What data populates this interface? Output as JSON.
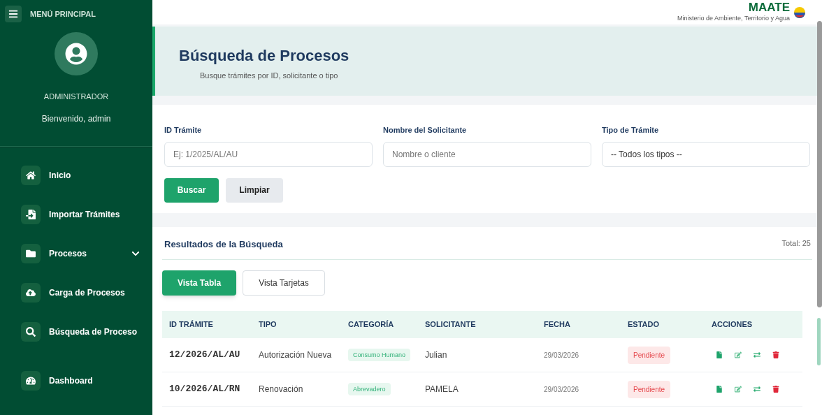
{
  "sidebar": {
    "menu_title": "MENÚ PRINCIPAL",
    "user_role": "ADMINISTRADOR",
    "welcome": "Bienvenido, admin",
    "items": [
      {
        "label": "Inicio",
        "expandable": false
      },
      {
        "label": "Importar Trámites",
        "expandable": false
      },
      {
        "label": "Procesos",
        "expandable": true
      },
      {
        "label": "Carga de Procesos",
        "expandable": false
      },
      {
        "label": "Búsqueda de Proceso",
        "expandable": false
      },
      {
        "label": "Dashboard",
        "expandable": false
      }
    ]
  },
  "header": {
    "logo": "MAATE",
    "ministry": "Ministerio de Ambiente, Territorio y Agua"
  },
  "page": {
    "title": "Búsqueda de Procesos",
    "subtitle": "Busque trámites por ID, solicitante o tipo"
  },
  "search_form": {
    "fields": [
      {
        "label": "ID Trámite",
        "placeholder": "Ej: 1/2025/AL/AU",
        "kind": "input"
      },
      {
        "label": "Nombre del Solicitante",
        "placeholder": "Nombre o cliente",
        "kind": "input"
      },
      {
        "label": "Tipo de Trámite",
        "value": "-- Todos los tipos --",
        "kind": "select"
      }
    ],
    "buttons": [
      {
        "label": "Buscar",
        "kind": "primary"
      },
      {
        "label": "Limpiar",
        "kind": "secondary"
      }
    ]
  },
  "results": {
    "title": "Resultados de la Búsqueda",
    "total": "Total: 25",
    "view_tabs": [
      {
        "label": "Vista Tabla",
        "selected": true
      },
      {
        "label": "Vista Tarjetas",
        "selected": false
      }
    ],
    "table": {
      "columns": [
        "ID TRÁMITE",
        "TIPO",
        "CATEGORÍA",
        "SOLICITANTE",
        "FECHA",
        "ESTADO",
        "ACCIONES"
      ],
      "rows": [
        {
          "id": "12/2026/AL/AU",
          "tipo": "Autorización Nueva",
          "categoria": "Consumo Humano",
          "solicitante": "Julian",
          "fecha": "29/03/2026",
          "estado": "Pendiente"
        },
        {
          "id": "10/2026/AL/RN",
          "tipo": "Renovación",
          "categoria": "Abrevadero",
          "solicitante": "PAMELA",
          "fecha": "29/03/2026",
          "estado": "Pendiente"
        }
      ]
    }
  }
}
